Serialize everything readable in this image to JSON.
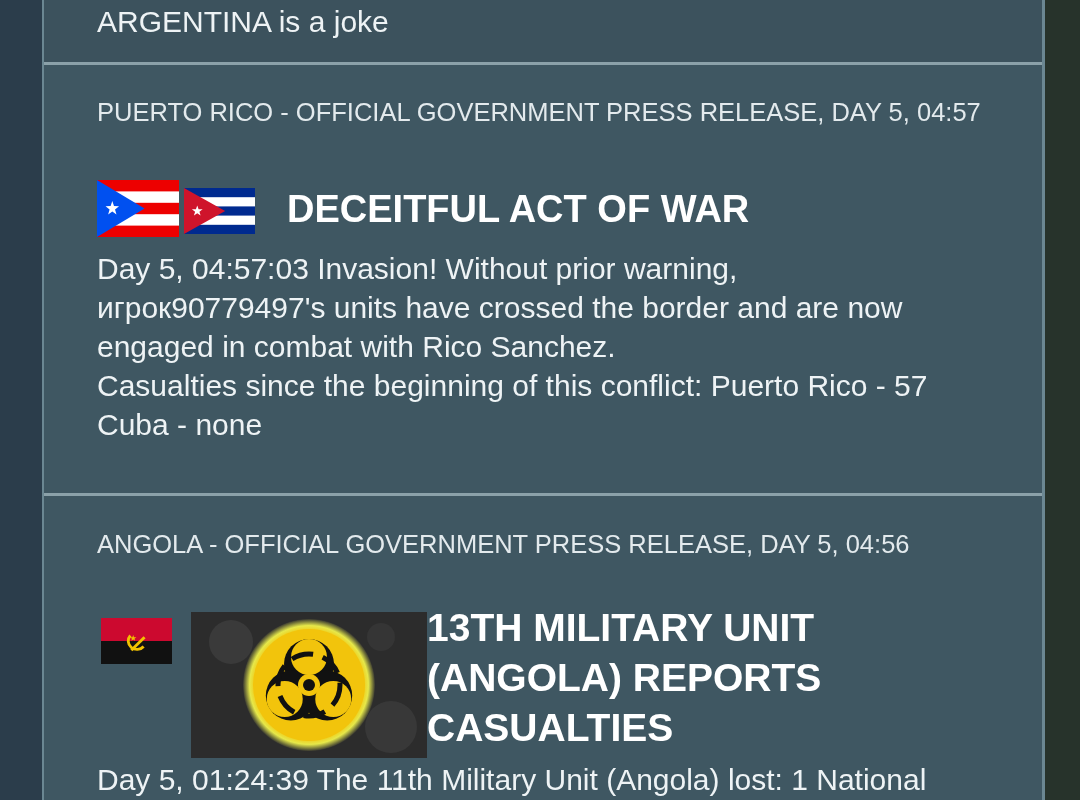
{
  "feed": [
    {
      "kind": "excerpt",
      "body": [
        "ARGENTINA is a joke"
      ]
    },
    {
      "kind": "war",
      "header": "PUERTO RICO - OFFICIAL GOVERNMENT PRESS RELEASE, DAY 5, 04:57",
      "title": "DECEITFUL ACT OF WAR",
      "body": [
        "Day 5, 04:57:03 Invasion! Without prior warning, игрок90779497's units have crossed the border and are now engaged in combat with Rico Sanchez.",
        "Casualties since the beginning of this conflict: Puerto Rico - 57",
        "Cuba - none"
      ]
    },
    {
      "kind": "casualties",
      "header": "ANGOLA - OFFICIAL GOVERNMENT PRESS RELEASE, DAY 5, 04:56",
      "title": "13TH MILITARY UNIT (ANGOLA) REPORTS CASUALTIES",
      "body": [
        "Day 5, 01:24:39 The 11th Military Unit (Angola) lost: 1 National"
      ]
    }
  ]
}
